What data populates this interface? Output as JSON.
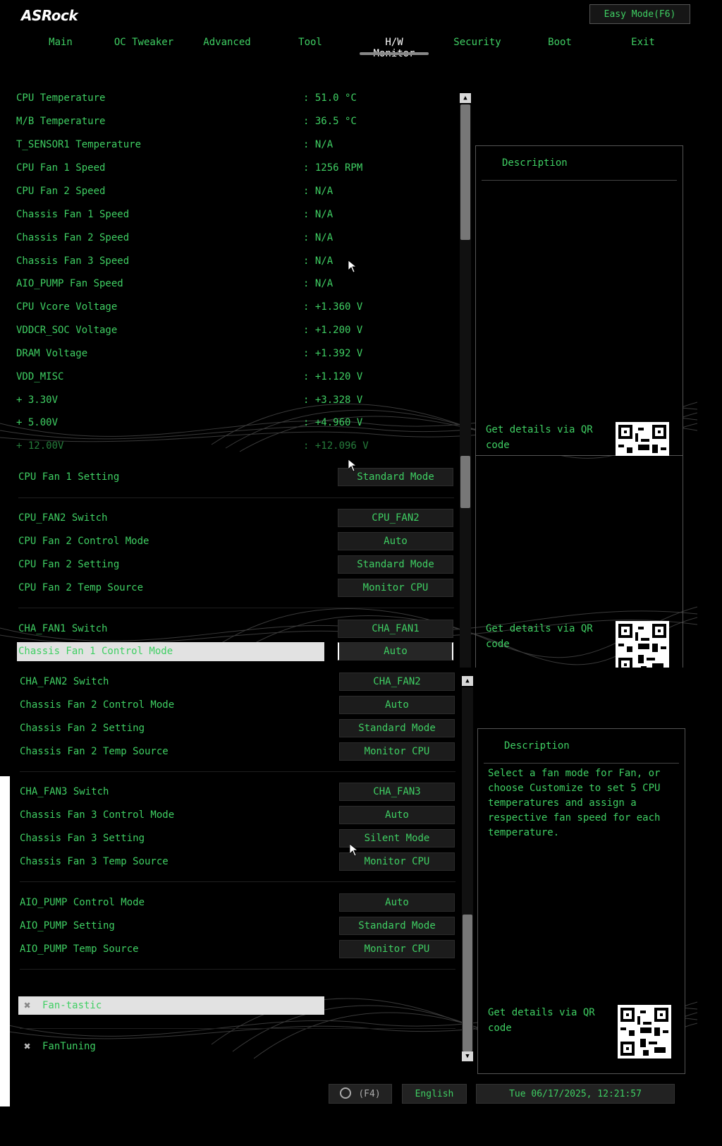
{
  "header": {
    "logo": "ASRock",
    "easy_mode": "Easy Mode(F6)",
    "tabs": [
      "Main",
      "OC Tweaker",
      "Advanced",
      "Tool",
      "H/W Monitor",
      "Security",
      "Boot",
      "Exit"
    ],
    "active_tab": "H/W Monitor"
  },
  "monitor": [
    {
      "label": "CPU Temperature",
      "value": ": 51.0 °C"
    },
    {
      "label": "M/B Temperature",
      "value": ": 36.5 °C"
    },
    {
      "label": "T_SENSOR1 Temperature",
      "value": ": N/A"
    },
    {
      "label": "CPU Fan 1 Speed",
      "value": ": 1256 RPM"
    },
    {
      "label": "CPU Fan 2 Speed",
      "value": ": N/A"
    },
    {
      "label": "Chassis Fan 1 Speed",
      "value": ": N/A"
    },
    {
      "label": "Chassis Fan 2 Speed",
      "value": ": N/A"
    },
    {
      "label": "Chassis Fan 3 Speed",
      "value": ": N/A"
    },
    {
      "label": "AIO_PUMP Fan Speed",
      "value": ": N/A"
    },
    {
      "label": "CPU Vcore Voltage",
      "value": ": +1.360 V"
    },
    {
      "label": "VDDCR_SOC Voltage",
      "value": ": +1.200 V"
    },
    {
      "label": "DRAM Voltage",
      "value": ": +1.392 V"
    },
    {
      "label": "VDD_MISC",
      "value": ": +1.120 V"
    },
    {
      "label": "+ 3.30V",
      "value": ": +3.328 V"
    },
    {
      "label": "+ 5.00V",
      "value": ": +4.960 V"
    },
    {
      "label": "+ 12.00V",
      "value": ": +12.096 V"
    }
  ],
  "section2": [
    {
      "label": "CPU Fan 1 Setting",
      "value": "Standard Mode"
    },
    {
      "label": "CPU_FAN2 Switch",
      "value": "CPU_FAN2"
    },
    {
      "label": "CPU Fan 2 Control Mode",
      "value": "Auto"
    },
    {
      "label": "CPU Fan 2 Setting",
      "value": "Standard Mode"
    },
    {
      "label": "CPU Fan 2 Temp Source",
      "value": "Monitor CPU"
    },
    {
      "label": "CHA_FAN1 Switch",
      "value": "CHA_FAN1"
    },
    {
      "label": "Chassis Fan 1 Control Mode",
      "value": "Auto"
    }
  ],
  "section3": [
    {
      "label": "CHA_FAN2 Switch",
      "value": "CHA_FAN2"
    },
    {
      "label": "Chassis Fan 2 Control Mode",
      "value": "Auto"
    },
    {
      "label": "Chassis Fan 2 Setting",
      "value": "Standard Mode"
    },
    {
      "label": "Chassis Fan 2 Temp Source",
      "value": "Monitor CPU"
    },
    {
      "label": "CHA_FAN3 Switch",
      "value": "CHA_FAN3"
    },
    {
      "label": "Chassis Fan 3 Control Mode",
      "value": "Auto"
    },
    {
      "label": "Chassis Fan 3 Setting",
      "value": "Silent Mode"
    },
    {
      "label": "Chassis Fan 3 Temp Source",
      "value": "Monitor CPU"
    },
    {
      "label": "AIO_PUMP Control Mode",
      "value": "Auto"
    },
    {
      "label": "AIO_PUMP Setting",
      "value": "Standard Mode"
    },
    {
      "label": "AIO_PUMP Temp Source",
      "value": "Monitor CPU"
    }
  ],
  "tools": [
    {
      "label": "Fan-tastic"
    },
    {
      "label": "FanTuning"
    }
  ],
  "description": {
    "title": "Description",
    "text_lines": [
      "Select a fan mode for Fan, or",
      "choose Customize to set 5 CPU",
      "temperatures and assign a",
      "respective fan speed for each",
      "temperature."
    ],
    "qr_line1": "Get details via QR",
    "qr_line2": "code"
  },
  "footer": {
    "search_hint": "(F4)",
    "language": "English",
    "datetime": "Tue 06/17/2025, 12:21:57"
  }
}
